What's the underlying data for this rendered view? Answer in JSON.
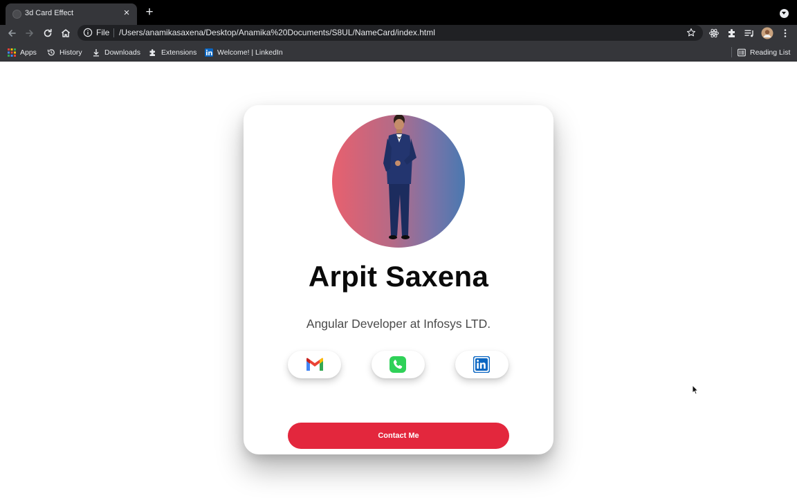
{
  "browser": {
    "tab_title": "3d Card Effect",
    "tab_close": "×",
    "new_tab": "+",
    "url_scheme": "File",
    "url": "/Users/anamikasaxena/Desktop/Anamika%20Documents/S8UL/NameCard/index.html",
    "bookmarks": [
      {
        "label": "Apps",
        "icon": "apps-grid-icon"
      },
      {
        "label": "History",
        "icon": "history-icon"
      },
      {
        "label": "Downloads",
        "icon": "download-icon"
      },
      {
        "label": "Extensions",
        "icon": "puzzle-icon"
      },
      {
        "label": "Welcome! | LinkedIn",
        "icon": "linkedin-icon"
      }
    ],
    "reading_list": "Reading List",
    "accent": "#35363a"
  },
  "card": {
    "name": "Arpit Saxena",
    "role": "Angular Developer at Infosys LTD.",
    "social": [
      {
        "icon": "gmail-icon"
      },
      {
        "icon": "phone-icon"
      },
      {
        "icon": "linkedin-icon"
      }
    ],
    "contact_label": "Contact Me",
    "button_color": "#e3273d",
    "avatar_gradient": [
      "#e8606e",
      "#4a78b0"
    ]
  }
}
